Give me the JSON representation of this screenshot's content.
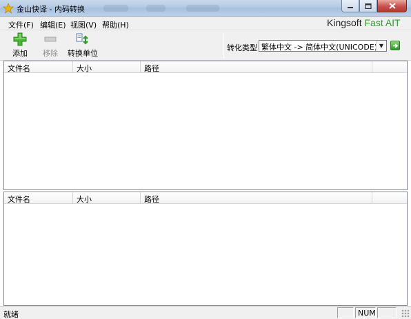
{
  "window": {
    "title": "金山快译 - 内码转换",
    "icon": "kingsoft-app-icon",
    "buttons": {
      "minimize": "minimize-icon",
      "maximize": "maximize-icon",
      "close": "close-icon"
    }
  },
  "menu": {
    "items": [
      {
        "label": "文件(F)"
      },
      {
        "label": "编辑(E)"
      },
      {
        "label": "视图(V)"
      },
      {
        "label": "帮助(H)"
      }
    ]
  },
  "brand": {
    "prefix": "Kingsoft ",
    "accent": "Fast AIT",
    "accent_color": "#2e9a2e"
  },
  "toolbar": {
    "add_label": "添加",
    "remove_label": "移除",
    "convert_unit_label": "转换单位",
    "conversion_type_label": "转化类型",
    "conversion_type_value": "繁体中文 -> 简体中文(UNICODE)"
  },
  "top_list": {
    "columns": [
      "文件名",
      "大小",
      "路径"
    ]
  },
  "bottom_list": {
    "columns": [
      "文件名",
      "大小",
      "路径"
    ]
  },
  "status": {
    "text": "就绪",
    "num_indicator": "NUM"
  }
}
